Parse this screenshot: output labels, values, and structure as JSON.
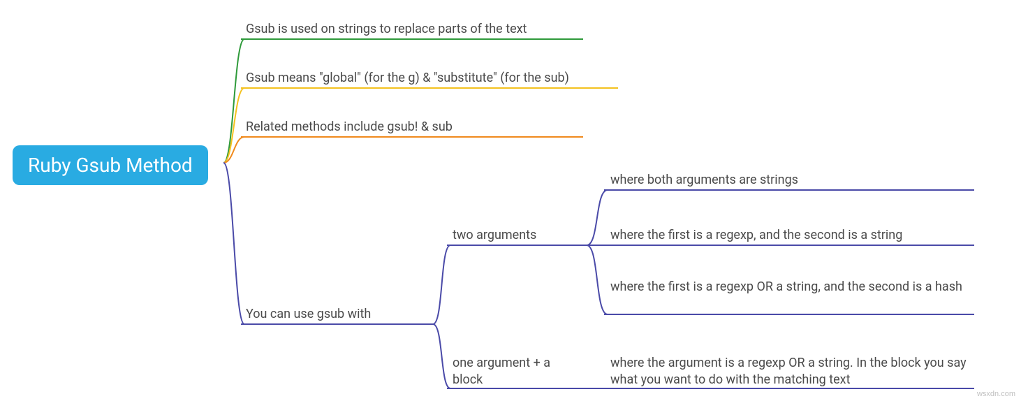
{
  "root": {
    "label": "Ruby Gsub Method"
  },
  "level1": {
    "n1": "Gsub is used on strings to replace parts of the text",
    "n2": "Gsub means \"global\" (for the g) & \"substitute\" (for the sub)",
    "n3": "Related methods include gsub! & sub",
    "n4": "You can use gsub with"
  },
  "level2": {
    "n4a": "two arguments",
    "n4b": "one argument + a block"
  },
  "level3": {
    "n4a1": "where both arguments are strings",
    "n4a2": "where the first is a regexp, and the second is a string",
    "n4a3": "where the first is a regexp OR a string, and the second is a hash",
    "n4b1": "where the argument is a regexp OR a string. In the block you say what you want to do with the matching text"
  },
  "colors": {
    "green": "#2e9a3a",
    "yellow": "#f4c21f",
    "orange": "#f08a1d",
    "indigo": "#4a4aa8"
  },
  "watermark": "wsxdn.com"
}
